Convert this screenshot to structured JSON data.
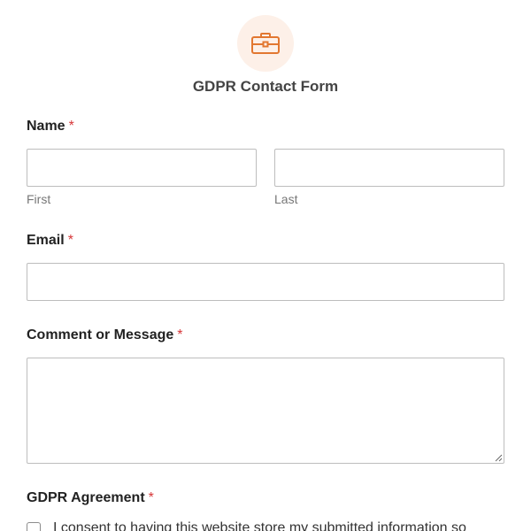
{
  "form": {
    "title": "GDPR Contact Form",
    "icon": "briefcase-icon",
    "accent_color": "#e27730",
    "required_color": "#d63638"
  },
  "fields": {
    "name": {
      "label": "Name",
      "required_mark": "*",
      "first": {
        "sublabel": "First",
        "value": ""
      },
      "last": {
        "sublabel": "Last",
        "value": ""
      }
    },
    "email": {
      "label": "Email",
      "required_mark": "*",
      "value": ""
    },
    "message": {
      "label": "Comment or Message",
      "required_mark": "*",
      "value": ""
    },
    "gdpr": {
      "label": "GDPR Agreement",
      "required_mark": "*",
      "checked": false,
      "consent_text": "I consent to having this website store my submitted information so"
    }
  }
}
